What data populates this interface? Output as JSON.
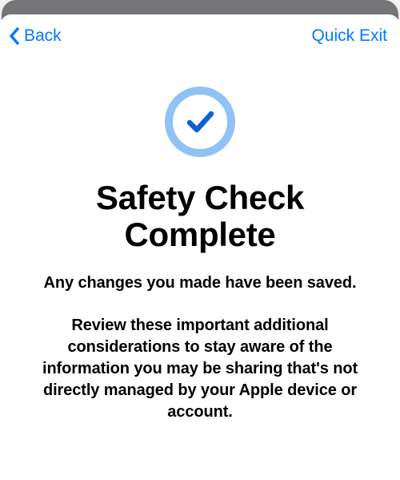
{
  "nav": {
    "back_label": "Back",
    "quick_exit_label": "Quick Exit"
  },
  "content": {
    "title": "Safety Check Complete",
    "subtitle": "Any changes you made have been saved.",
    "body": "Review these important additional considerations to stay aware of the information you may be sharing that's not directly managed by your Apple device or account."
  },
  "colors": {
    "accent": "#007aff",
    "ring": "#8fc3f4",
    "check": "#0a60d8"
  }
}
